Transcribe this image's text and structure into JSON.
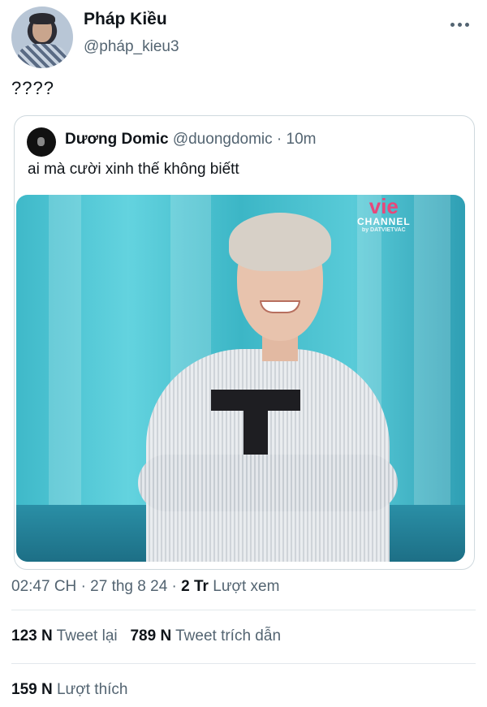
{
  "author": {
    "name": "Pháp Kiều",
    "handle": "@pháp_kieu3"
  },
  "tweet": {
    "text": "????"
  },
  "quoted": {
    "name": "Dương Domic",
    "handle": "@duongdomic",
    "separator": "·",
    "time": "10m",
    "text": "ai mà cười xinh thế không biếtt",
    "media": {
      "watermark_logo": "vie",
      "watermark_channel": "CHANNEL",
      "watermark_sub": "by DATVIETVAC"
    }
  },
  "meta": {
    "time": "02:47 CH",
    "sep1": "·",
    "date": "27 thg 8 24",
    "sep2": "·",
    "views_count": "2 Tr",
    "views_label": "Lượt xem"
  },
  "stats": {
    "retweets_count": "123 N",
    "retweets_label": "Tweet lại",
    "quotes_count": "789 N",
    "quotes_label": "Tweet trích dẫn",
    "likes_count": "159 N",
    "likes_label": "Lượt thích"
  },
  "colors": {
    "text_primary": "#0f1419",
    "text_secondary": "#536471",
    "border": "#cfd9de"
  },
  "icons": {
    "more": "more-horizontal-icon"
  }
}
